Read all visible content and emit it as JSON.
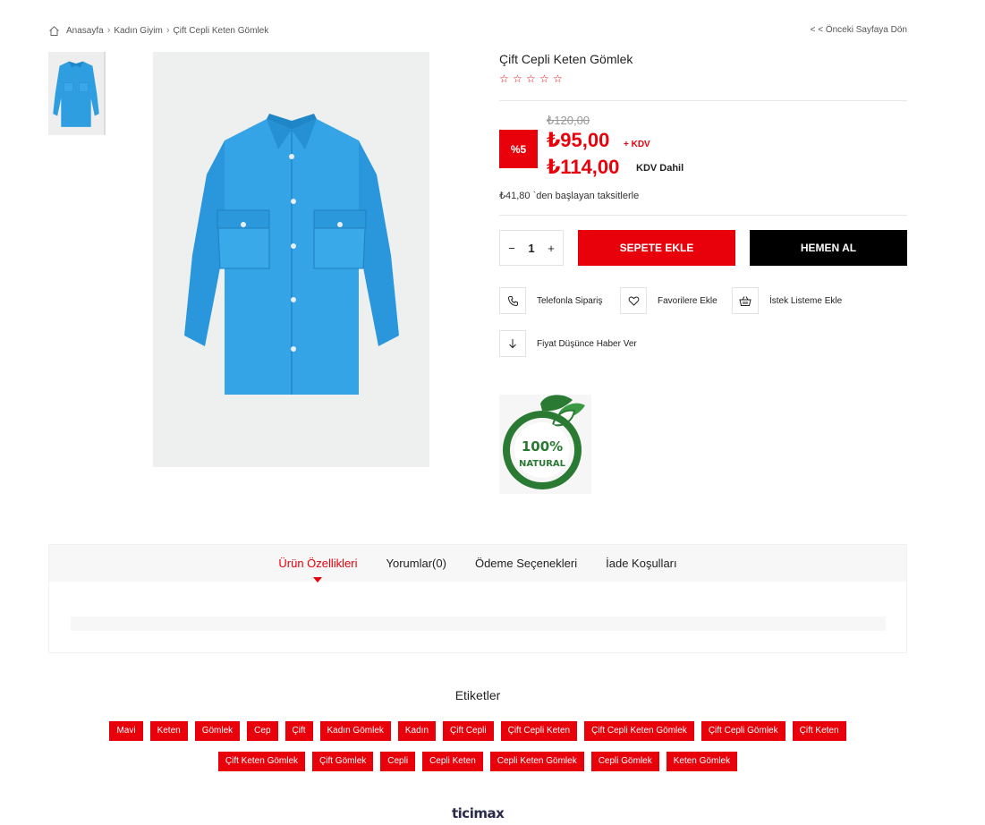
{
  "breadcrumb": {
    "items": [
      "Anasayfa",
      "Kadın Giyim",
      "Çift Cepli Keten Gömlek"
    ],
    "back_label": "< < Önceki Sayfaya Dön"
  },
  "product": {
    "title": "Çift Cepli Keten Gömlek",
    "rating": 0,
    "rating_max": 5,
    "old_price": "₺120,00",
    "discount": "%5",
    "price": "₺95,00",
    "kdv_plus": "+ KDV",
    "price_with_tax": "₺114,00",
    "kdv_included": "KDV Dahil",
    "installment": "₺41,80 `den başlayan taksitlerle"
  },
  "purchase": {
    "quantity": "1",
    "minus": "−",
    "plus": "+",
    "add_to_cart": "SEPETE EKLE",
    "buy_now": "HEMEN AL"
  },
  "actions": {
    "phone_order": "Telefonla Sipariş",
    "favorites": "Favorilere Ekle",
    "wishlist": "İstek Listeme Ekle",
    "price_alert": "Fiyat Düşünce Haber Ver"
  },
  "badge": {
    "percent": "100%",
    "word": "NATURAL"
  },
  "tabs": [
    {
      "label": "Ürün Özellikleri",
      "active": true
    },
    {
      "label": "Yorumlar(0)",
      "active": false
    },
    {
      "label": "Ödeme Seçenekleri",
      "active": false
    },
    {
      "label": "İade Koşulları",
      "active": false
    }
  ],
  "tags": {
    "title": "Etiketler",
    "row1": [
      "Mavi",
      "Keten",
      "Gömlek",
      "Cep",
      "Çift",
      "Kadın Gömlek",
      "Kadın",
      "Çift Cepli",
      "Çift Cepli Keten",
      "Çift Cepli Keten Gömlek",
      "Çift Cepli Gömlek",
      "Çift Keten"
    ],
    "row2": [
      "Çift Keten Gömlek",
      "Çift Gömlek",
      "Cepli",
      "Cepli Keten",
      "Cepli Keten Gömlek",
      "Cepli Gömlek",
      "Keten Gömlek"
    ]
  },
  "footer": {
    "brand": "ticimax"
  },
  "colors": {
    "accent": "#e8000b",
    "shirt": "#2e9ee0",
    "badge_green": "#2a7a34"
  }
}
